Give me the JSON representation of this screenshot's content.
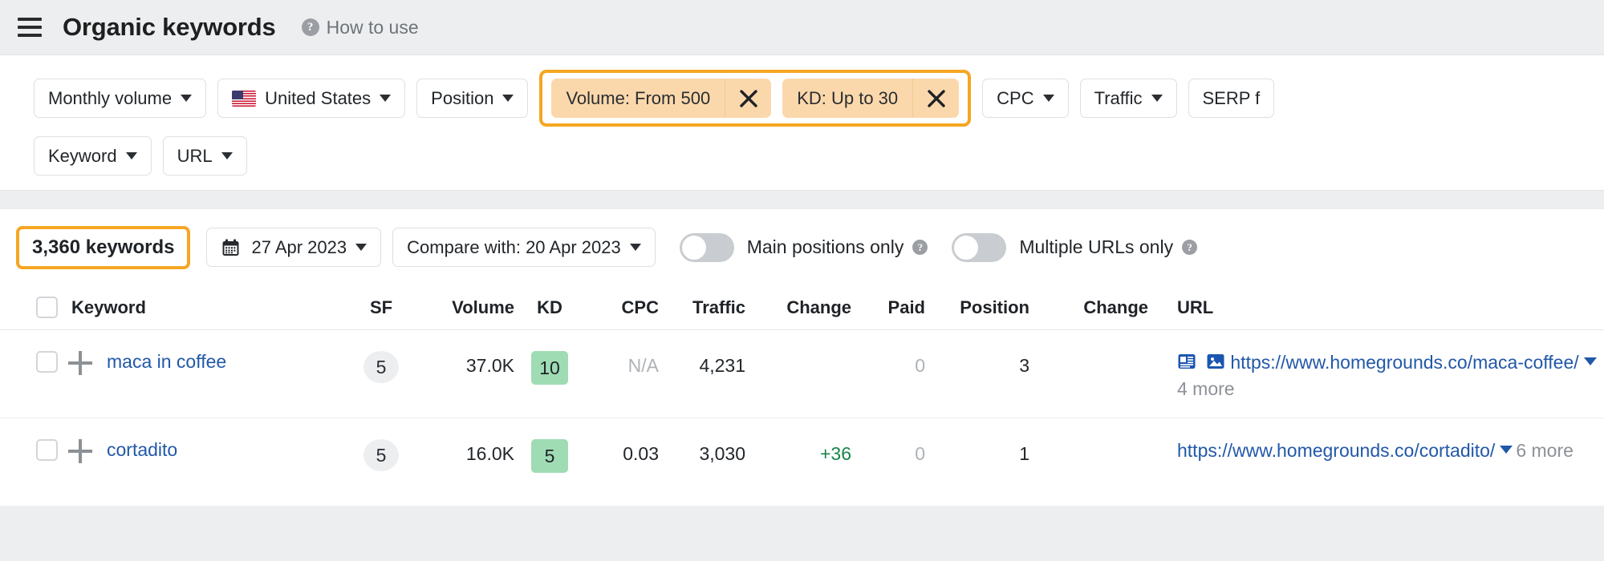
{
  "header": {
    "menu_icon": "hamburger-icon",
    "title": "Organic keywords",
    "help_icon": "question-mark-icon",
    "how_to_use": "How to use"
  },
  "filters": {
    "row1": [
      {
        "label": "Monthly volume",
        "type": "dropdown",
        "name": "monthly-volume"
      },
      {
        "label": "United States",
        "type": "dropdown",
        "name": "country",
        "icon": "us-flag-icon"
      },
      {
        "label": "Position",
        "type": "dropdown",
        "name": "position"
      }
    ],
    "active_chips": [
      {
        "label": "Volume: From 500",
        "name": "volume-chip",
        "remove_icon": "close-icon"
      },
      {
        "label": "KD: Up to 30",
        "name": "kd-chip",
        "remove_icon": "close-icon"
      }
    ],
    "row1_after": [
      {
        "label": "CPC",
        "type": "dropdown",
        "name": "cpc"
      },
      {
        "label": "Traffic",
        "type": "dropdown",
        "name": "traffic"
      },
      {
        "label": "SERP f",
        "type": "dropdown",
        "name": "serp-features"
      }
    ],
    "row2": [
      {
        "label": "Keyword",
        "type": "dropdown",
        "name": "keyword"
      },
      {
        "label": "URL",
        "type": "dropdown",
        "name": "url"
      }
    ],
    "highlight_color": "#f5a623",
    "chip_color": "#fbd8ac"
  },
  "toolbar": {
    "keyword_count": "3,360 keywords",
    "date": "27 Apr 2023",
    "calendar_icon": "calendar-icon",
    "compare_with": "Compare with: 20 Apr 2023",
    "toggles": [
      {
        "label": "Main positions only",
        "on": false,
        "help_icon": "question-mark-icon",
        "name": "main-positions-only"
      },
      {
        "label": "Multiple URLs only",
        "on": false,
        "help_icon": "question-mark-icon",
        "name": "multiple-urls-only"
      }
    ]
  },
  "table": {
    "columns": [
      "Keyword",
      "SF",
      "Volume",
      "KD",
      "CPC",
      "Traffic",
      "Change",
      "Paid",
      "Position",
      "Change",
      "URL"
    ],
    "rows": [
      {
        "keyword": "maca in coffee",
        "sf": "5",
        "volume": "37.0K",
        "kd": "10",
        "cpc": "N/A",
        "cpc_muted": true,
        "traffic": "4,231",
        "change": "",
        "paid": "0",
        "position": "3",
        "position_change": "",
        "url": "https://www.homegrounds.co/maca-coffee/",
        "url_more": "4 more",
        "url_icons": [
          "sitelinks-icon",
          "image-pack-icon"
        ]
      },
      {
        "keyword": "cortadito",
        "sf": "5",
        "volume": "16.0K",
        "kd": "5",
        "cpc": "0.03",
        "cpc_muted": false,
        "traffic": "3,030",
        "change": "+36",
        "paid": "0",
        "position": "1",
        "position_change": "",
        "url": "https://www.homegrounds.co/cortadito/",
        "url_more": "6 more",
        "url_icons": []
      }
    ]
  },
  "colors": {
    "link": "#2158a8",
    "positive": "#17864a",
    "kd_badge": "#9fdcb4",
    "highlight": "#f5a623"
  }
}
